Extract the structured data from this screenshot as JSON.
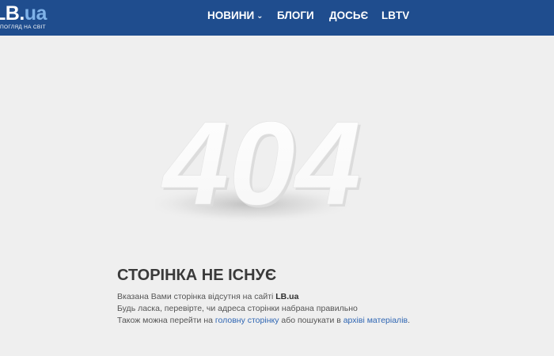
{
  "header": {
    "logo": {
      "main": "LB",
      "dot": ".",
      "suffix": "ua",
      "tagline": "ПОГЛЯД НА СВІТ"
    },
    "nav": [
      {
        "label": "НОВИНИ",
        "has_dropdown": true,
        "chevron": "⌄"
      },
      {
        "label": "БЛОГИ"
      },
      {
        "label": "ДОСЬЄ"
      },
      {
        "label": "LBTV"
      }
    ],
    "bg_color": "#1f4d8e"
  },
  "error": {
    "code": "404",
    "title": "СТОРІНКА НЕ ІСНУЄ",
    "line1_prefix": "Вказана Вами сторінка відсутня на сайті ",
    "line1_site": "LB.ua",
    "line2": "Будь ласка, перевірте, чи адреса сторінки набрана правильно",
    "line3_prefix": "Також можна перейти на ",
    "line3_link1": "головну сторінку",
    "line3_middle": " або пошукати в ",
    "line3_link2": "архіві матеріалів",
    "line3_suffix": "."
  },
  "colors": {
    "background": "#efefef",
    "link": "#2f66b3",
    "heading": "#3a3a3a"
  }
}
